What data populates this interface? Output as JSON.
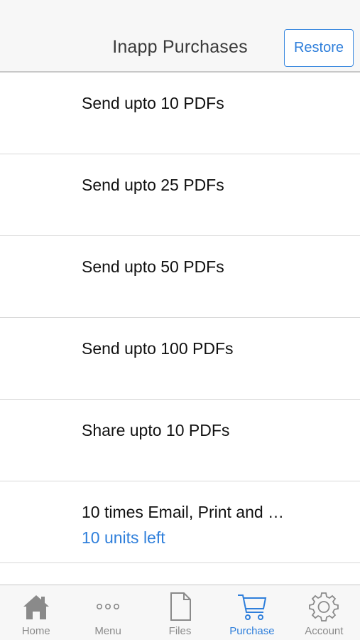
{
  "nav": {
    "title": "Inapp Purchases",
    "restore_label": "Restore"
  },
  "items": [
    {
      "title": "Send upto 10 PDFs",
      "subtitle": ""
    },
    {
      "title": "Send upto 25 PDFs",
      "subtitle": ""
    },
    {
      "title": "Send upto 50 PDFs",
      "subtitle": ""
    },
    {
      "title": "Send upto 100 PDFs",
      "subtitle": ""
    },
    {
      "title": "Share upto 10 PDFs",
      "subtitle": ""
    },
    {
      "title": "10 times Email, Print and …",
      "subtitle": "10 units left"
    }
  ],
  "tabs": [
    {
      "label": "Home",
      "icon": "home-icon",
      "active": false
    },
    {
      "label": "Menu",
      "icon": "more-dots-icon",
      "active": false
    },
    {
      "label": "Files",
      "icon": "file-icon",
      "active": false
    },
    {
      "label": "Purchase",
      "icon": "cart-icon",
      "active": true
    },
    {
      "label": "Account",
      "icon": "gear-icon",
      "active": false
    }
  ],
  "colors": {
    "accent": "#2f7fdb",
    "inactive": "#8a8a8a"
  }
}
